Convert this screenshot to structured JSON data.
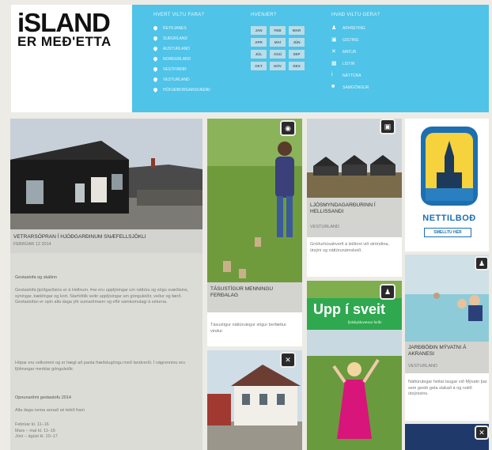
{
  "logo": {
    "line1": "iSLAND",
    "line2": "ER MEÐ'ETTA"
  },
  "nav": {
    "regions_heading": "HVERT VILTU FARA?",
    "regions": [
      "REYKJANES",
      "SUÐURLAND",
      "AUSTURLAND",
      "NORÐURLAND",
      "VESTFIRÐIR",
      "VESTURLAND",
      "HÖFUÐBORGARSVÆÐIÐ"
    ],
    "months_heading": "HVENÆR?",
    "months": [
      "JAN",
      "FEB",
      "MAR",
      "APR",
      "MAÍ",
      "JÚN",
      "JÚL",
      "ÁGÚ",
      "SEP",
      "OKT",
      "NÓV",
      "DES"
    ],
    "categories_heading": "HVAÐ VILTU GERA?",
    "categories": [
      "AFÞREYING",
      "GISTING",
      "MATUR",
      "LISTIR",
      "NÁTTÚRA",
      "SAMGÖNGUR"
    ],
    "category_icons": [
      "hiking-icon",
      "bed-icon",
      "cutlery-icon",
      "art-icon",
      "info-icon",
      "bus-icon"
    ]
  },
  "feature": {
    "caption": "VETRARSÓPRAN Í HJÓÐGARÐINUM SNÆFELLSJÖKLI",
    "date": "FEBRÚAR 12 2014",
    "intro": "Gestastofa og skálinn",
    "body1": "Gestastofa þjóðgarðsins er á Hellnum. Þar eru upplýsingar um náttúru og sögu svæðisins, sýningar, bæklingar og kort. Starfsfólk veitir upplýsingar um gönguleiðir, veður og færð. Gestastofan er opin alla daga yfir sumartímann og eftir samkomulagi á veturna.",
    "body2": "Hópar eru velkomnir og er hægt að panta fræðslugöngu með landverði. Í nágrenninu eru fjölmargar merktar gönguleiðir.",
    "hours_title": "Opnunartími gestastofu 2014",
    "hours_sub": "Alla daga nema annað sé tekið fram",
    "hours": [
      "Febrúar kl. 11–16",
      "Mars – maí kl. 11–16",
      "Júní – ágúst kl. 10–17"
    ]
  },
  "cards": {
    "woman": {
      "caption": "TÁSUSTÍGUR MENNINGU FERÐALAG",
      "desc": "Tásustígur náttúrulegur stígur berfættur vindur."
    },
    "cabins": {
      "caption": "LJÓSMYNDAGARÐURINN Í HELLISSANDI",
      "region": "VESTURLAND",
      "desc": "Gróðurhúsahverfi á leiðinni við ströndina, útsýni og náttúrunámskeið."
    },
    "ad": {
      "brand": "NETTILBOÐ",
      "cta": "SMELLTU HÉR"
    },
    "uppisveit": {
      "title": "Upp í sveit",
      "sub": "fjölskylduvænar ferðir"
    },
    "lagoon": {
      "caption": "JARÐBÖÐIN MÝVATNI Á AKRANESI",
      "region": "VESTURLAND",
      "desc": "Náttúrulegar heitar laugar við Mývatn þar sem gestir geta slakað á og notið útsýnisins."
    }
  },
  "colors": {
    "header_blue": "#4fc3e8",
    "ad_yellow": "#f6d23c",
    "upp_green": "#2fa84f"
  }
}
